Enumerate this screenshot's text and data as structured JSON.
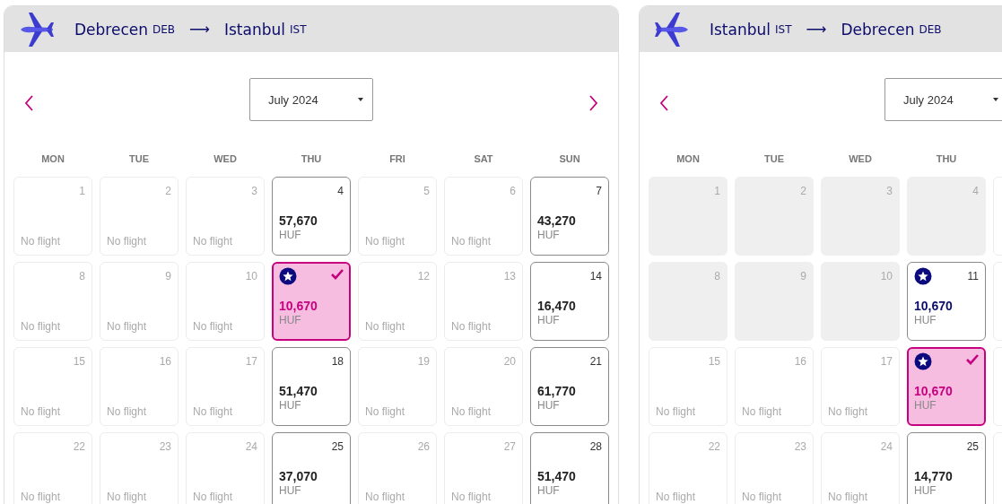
{
  "panels": [
    {
      "kind": "outbound",
      "from": "Debrecen",
      "from_code": "DEB",
      "arrow": "⟶",
      "to": "Istanbul",
      "to_code": "IST",
      "month": "July 2024",
      "next_visible": true,
      "weekdays": [
        "MON",
        "TUE",
        "WED",
        "THU",
        "FRI",
        "SAT",
        "SUN"
      ],
      "weeks": [
        [
          {
            "day": "1",
            "kind": "none",
            "note": "No flight"
          },
          {
            "day": "2",
            "kind": "none",
            "note": "No flight"
          },
          {
            "day": "3",
            "kind": "none",
            "note": "No flight"
          },
          {
            "day": "4",
            "kind": "price",
            "price": "57,670",
            "currency": "HUF",
            "deal": false,
            "selected": false
          },
          {
            "day": "5",
            "kind": "none",
            "note": "No flight"
          },
          {
            "day": "6",
            "kind": "none",
            "note": "No flight"
          },
          {
            "day": "7",
            "kind": "price",
            "price": "43,270",
            "currency": "HUF",
            "deal": false,
            "selected": false
          }
        ],
        [
          {
            "day": "8",
            "kind": "none",
            "note": "No flight"
          },
          {
            "day": "9",
            "kind": "none",
            "note": "No flight"
          },
          {
            "day": "10",
            "kind": "none",
            "note": "No flight"
          },
          {
            "kind": "price",
            "price": "10,670",
            "currency": "HUF",
            "deal": true,
            "selected": true
          },
          {
            "day": "12",
            "kind": "none",
            "note": "No flight"
          },
          {
            "day": "13",
            "kind": "none",
            "note": "No flight"
          },
          {
            "day": "14",
            "kind": "price",
            "price": "16,470",
            "currency": "HUF",
            "deal": false,
            "selected": false
          }
        ],
        [
          {
            "day": "15",
            "kind": "none",
            "note": "No flight"
          },
          {
            "day": "16",
            "kind": "none",
            "note": "No flight"
          },
          {
            "day": "17",
            "kind": "none",
            "note": "No flight"
          },
          {
            "day": "18",
            "kind": "price",
            "price": "51,470",
            "currency": "HUF",
            "deal": false,
            "selected": false
          },
          {
            "day": "19",
            "kind": "none",
            "note": "No flight"
          },
          {
            "day": "20",
            "kind": "none",
            "note": "No flight"
          },
          {
            "day": "21",
            "kind": "price",
            "price": "61,770",
            "currency": "HUF",
            "deal": false,
            "selected": false
          }
        ],
        [
          {
            "day": "22",
            "kind": "none",
            "note": "No flight"
          },
          {
            "day": "23",
            "kind": "none",
            "note": "No flight"
          },
          {
            "day": "24",
            "kind": "none",
            "note": "No flight"
          },
          {
            "day": "25",
            "kind": "price",
            "price": "37,070",
            "currency": "HUF",
            "deal": false,
            "selected": false
          },
          {
            "day": "26",
            "kind": "none",
            "note": "No flight"
          },
          {
            "day": "27",
            "kind": "none",
            "note": "No flight"
          },
          {
            "day": "28",
            "kind": "price",
            "price": "51,470",
            "currency": "HUF",
            "deal": false,
            "selected": false
          }
        ]
      ]
    },
    {
      "kind": "inbound",
      "from": "Istanbul",
      "from_code": "IST",
      "arrow": "⟶",
      "to": "Debrecen",
      "to_code": "DEB",
      "month": "July 2024",
      "next_visible": false,
      "weekdays": [
        "MON",
        "TUE",
        "WED",
        "THU"
      ],
      "weeks": [
        [
          {
            "day": "1",
            "kind": "past"
          },
          {
            "day": "2",
            "kind": "past"
          },
          {
            "day": "3",
            "kind": "past"
          },
          {
            "day": "4",
            "kind": "past"
          }
        ],
        [
          {
            "day": "8",
            "kind": "past"
          },
          {
            "day": "9",
            "kind": "past"
          },
          {
            "day": "10",
            "kind": "past"
          },
          {
            "day": "11",
            "kind": "price",
            "price": "10,670",
            "currency": "HUF",
            "deal": true,
            "selected": false
          }
        ],
        [
          {
            "day": "15",
            "kind": "none",
            "note": "No flight"
          },
          {
            "day": "16",
            "kind": "none",
            "note": "No flight"
          },
          {
            "day": "17",
            "kind": "none",
            "note": "No flight"
          },
          {
            "kind": "price",
            "price": "10,670",
            "currency": "HUF",
            "deal": true,
            "selected": true
          }
        ],
        [
          {
            "day": "22",
            "kind": "none",
            "note": "No flight"
          },
          {
            "day": "23",
            "kind": "none",
            "note": "No flight"
          },
          {
            "day": "24",
            "kind": "none",
            "note": "No flight"
          },
          {
            "day": "25",
            "kind": "price",
            "price": "14,770",
            "currency": "HUF",
            "deal": false,
            "selected": false
          }
        ]
      ]
    }
  ]
}
